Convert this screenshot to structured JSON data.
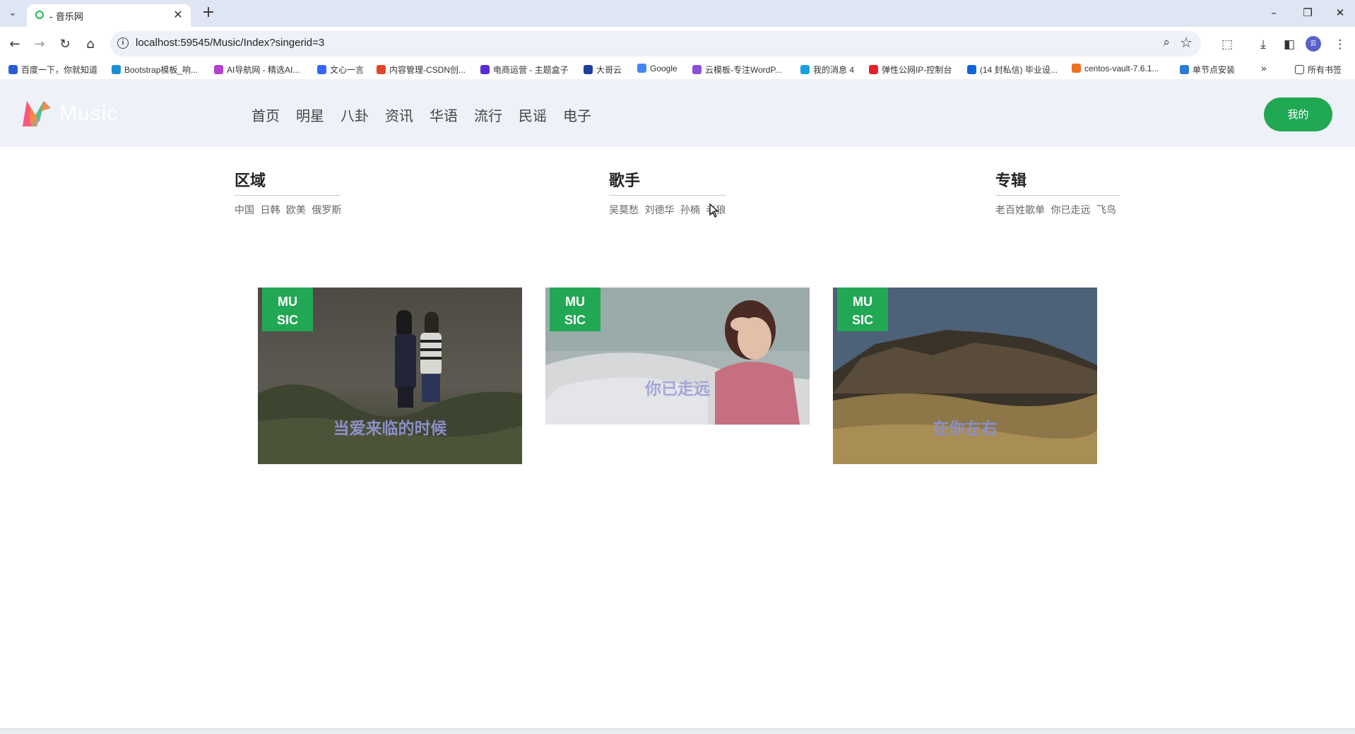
{
  "browser": {
    "tab_title": "- 音乐网",
    "url": "localhost:59545/Music/Index?singerid=3",
    "bookmarks": [
      {
        "label": "百度一下，你就知道",
        "color": "#2a5bd7"
      },
      {
        "label": "Bootstrap模板_响...",
        "color": "#1a8fd6"
      },
      {
        "label": "AI导航网 - 精选AI...",
        "color": "#b440d0"
      },
      {
        "label": "文心一言",
        "color": "#3366ff"
      },
      {
        "label": "内容管理-CSDN创...",
        "color": "#e4452a"
      },
      {
        "label": "电商运营 - 主题盒子",
        "color": "#5a2bd6"
      },
      {
        "label": "大哥云",
        "color": "#1c3f9e"
      },
      {
        "label": "Google",
        "color": "#4285f4"
      },
      {
        "label": "云模板-专注WordP...",
        "color": "#8a4fd6"
      },
      {
        "label": "我的消息 4",
        "color": "#1aa0e0"
      },
      {
        "label": "弹性公网IP-控制台",
        "color": "#e4202a"
      },
      {
        "label": "(14 封私信) 毕业设...",
        "color": "#0f65d6"
      },
      {
        "label": "centos-vault-7.6.1...",
        "color": "#f07020"
      },
      {
        "label": "单节点安装",
        "color": "#2a7bd6"
      }
    ],
    "all_bookmarks": "所有书签",
    "icons": {
      "back": "back-arrow-icon",
      "forward": "forward-arrow-icon",
      "reload": "reload-icon",
      "home": "home-icon"
    }
  },
  "site": {
    "logo_text": "Music",
    "nav": [
      "首页",
      "明星",
      "八卦",
      "资讯",
      "华语",
      "流行",
      "民谣",
      "电子"
    ],
    "my_button": "我的",
    "accent_color": "#21a853"
  },
  "filters": {
    "region": {
      "title": "区域",
      "items": [
        "中国",
        "日韩",
        "欧美",
        "俄罗斯"
      ]
    },
    "singer": {
      "title": "歌手",
      "items": [
        "吴莫愁",
        "刘德华",
        "孙楠",
        "老狼"
      ]
    },
    "album": {
      "title": "专辑",
      "items": [
        "老百姓歌单",
        "你已走远",
        "飞鸟"
      ]
    }
  },
  "cards": [
    {
      "badge_line1": "MU",
      "badge_line2": "SIC",
      "title": "当爱来临的时候"
    },
    {
      "badge_line1": "MU",
      "badge_line2": "SIC",
      "title": "你已走远"
    },
    {
      "badge_line1": "MU",
      "badge_line2": "SIC",
      "title": "在你左右"
    }
  ]
}
